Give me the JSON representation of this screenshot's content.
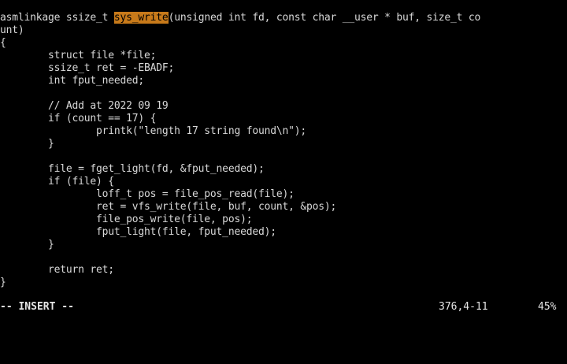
{
  "editor": {
    "lines": [
      {
        "text": "asmlinkage ssize_t "
      },
      {
        "text": "unt)"
      },
      {
        "text": "{"
      },
      {
        "text": "        struct file *file;"
      },
      {
        "text": "        ssize_t ret = -EBADF;"
      },
      {
        "text": "        int fput_needed;"
      },
      {
        "text": ""
      },
      {
        "text": "        // Add at 2022 09 19"
      },
      {
        "text": "        if (count == 17) {"
      },
      {
        "text": "                printk(\"length 17 string found\\n\");"
      },
      {
        "text": "        }"
      },
      {
        "text": ""
      },
      {
        "text": "        file = fget_light(fd, &fput_needed);"
      },
      {
        "text": "        if (file) {"
      },
      {
        "text": "                loff_t pos = file_pos_read(file);"
      },
      {
        "text": "                ret = vfs_write(file, buf, count, &pos);"
      },
      {
        "text": "                file_pos_write(file, pos);"
      },
      {
        "text": "                fput_light(file, fput_needed);"
      },
      {
        "text": "        }"
      },
      {
        "text": ""
      },
      {
        "text": "        return ret;"
      },
      {
        "text": "}"
      }
    ],
    "first_line_highlight": "sys_write",
    "first_line_rest": "(unsigned int fd, const char __user * buf, size_t co"
  },
  "status": {
    "mode": "-- INSERT --",
    "cursor_position": "376,4-11",
    "scroll_percent": "45%"
  },
  "colors": {
    "background": "#000000",
    "text": "#d8d8d8",
    "search_highlight": "#c87a1a"
  }
}
